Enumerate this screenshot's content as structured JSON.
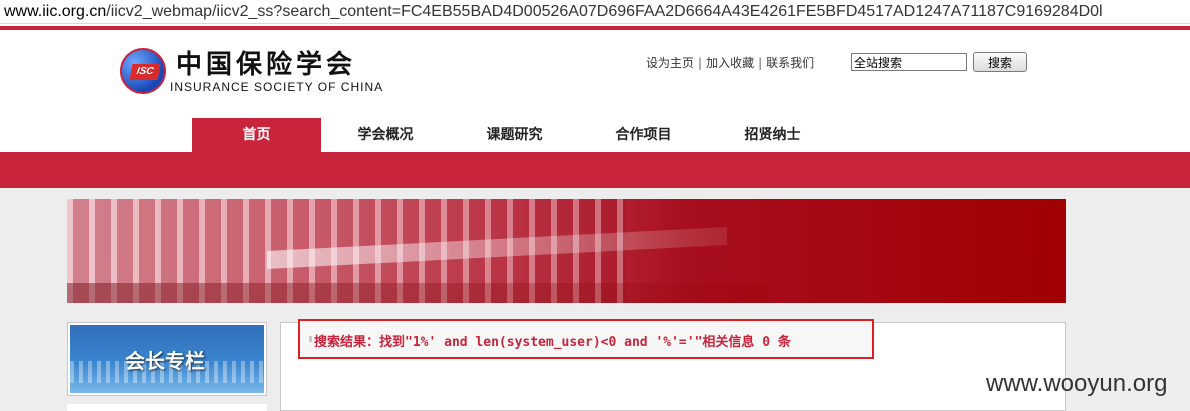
{
  "browser": {
    "url_domain": "www.iic.org.cn",
    "url_path": "/iicv2_webmap/iicv2_ss?search_content=FC4EB55BAD4D00526A07D696FAA2D6664A43E4261FE5BFD4517AD1247A71187C9169284D0l"
  },
  "header": {
    "logo_badge": "ISC",
    "logo_cn": "中国保险学会",
    "logo_en": "INSURANCE  SOCIETY  OF  CHINA",
    "links": [
      "设为主页",
      "加入收藏",
      "联系我们"
    ],
    "separator": "|",
    "search_value": "全站搜索",
    "search_button": "搜索"
  },
  "nav": {
    "items": [
      "首页",
      "学会概况",
      "课题研究",
      "合作项目",
      "招贤纳士"
    ],
    "active_index": 0
  },
  "sidebar": {
    "title": "会长专栏"
  },
  "result": {
    "text": "搜索结果：找到\"1%' and len(system_user)<0 and '%'='\"相关信息 0 条"
  },
  "watermark": "www.wooyun.org",
  "colors": {
    "brand_red": "#c8243c",
    "highlight_border": "#e02020"
  }
}
